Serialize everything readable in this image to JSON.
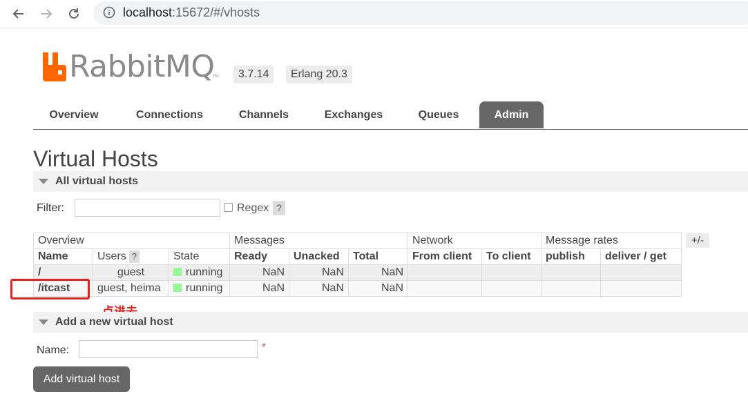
{
  "browser": {
    "url_host": "localhost",
    "url_rest": ":15672/#/vhosts"
  },
  "brand": {
    "name": "RabbitMQ",
    "trademark": "TM",
    "version": "3.7.14",
    "erlang": "Erlang 20.3",
    "logo_color": "#ff6600"
  },
  "tabs": [
    "Overview",
    "Connections",
    "Channels",
    "Exchanges",
    "Queues",
    "Admin"
  ],
  "page_title": "Virtual Hosts",
  "all_section": {
    "title": "All virtual hosts",
    "filter_label": "Filter:",
    "regex_label": "Regex",
    "help": "?"
  },
  "table": {
    "groups": [
      "Overview",
      "Messages",
      "Network",
      "Message rates"
    ],
    "plus_minus": "+/-",
    "columns": [
      "Name",
      "Users",
      "State",
      "Ready",
      "Unacked",
      "Total",
      "From client",
      "To client",
      "publish",
      "deliver / get"
    ],
    "users_help": "?",
    "rows": [
      {
        "name": "/",
        "users": "guest",
        "state": "running",
        "ready": "NaN",
        "unacked": "NaN",
        "total": "NaN"
      },
      {
        "name": "/itcast",
        "users": "guest, heima",
        "state": "running",
        "ready": "NaN",
        "unacked": "NaN",
        "total": "NaN"
      }
    ]
  },
  "annotation": "点进去",
  "add_section": {
    "title": "Add a new virtual host",
    "name_label": "Name:",
    "required_mark": "*",
    "button": "Add virtual host"
  }
}
